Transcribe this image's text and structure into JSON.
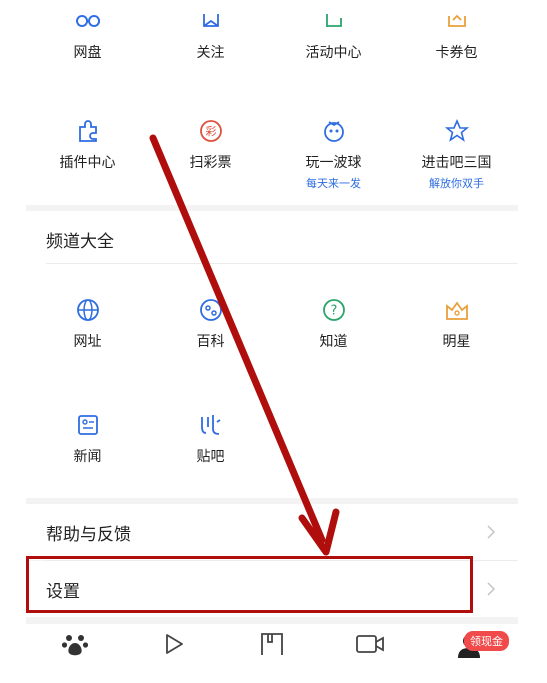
{
  "top_row": [
    {
      "icon": "cloud-drive-icon",
      "label": "网盘",
      "color": "#2f6de1"
    },
    {
      "icon": "follow-icon",
      "label": "关注",
      "color": "#2f6de1"
    },
    {
      "icon": "flag-icon",
      "label": "活动中心",
      "color": "#2aa56b"
    },
    {
      "icon": "coupon-icon",
      "label": "卡券包",
      "color": "#e8a13a"
    }
  ],
  "second_row": [
    {
      "icon": "plugin-icon",
      "label": "插件中心",
      "sub": "",
      "color": "#2f6de1"
    },
    {
      "icon": "lottery-icon",
      "label": "扫彩票",
      "sub": "",
      "color": "#e0503f"
    },
    {
      "icon": "game-ball-icon",
      "label": "玩一波球",
      "sub": "每天来一发",
      "color": "#2f6de1"
    },
    {
      "icon": "game-star-icon",
      "label": "进击吧三国",
      "sub": "解放你双手",
      "color": "#2f6de1"
    }
  ],
  "channels": {
    "title": "频道大全",
    "row1": [
      {
        "icon": "globe-icon",
        "label": "网址",
        "color": "#2f6de1"
      },
      {
        "icon": "encyclopedia-icon",
        "label": "百科",
        "color": "#2f6de1"
      },
      {
        "icon": "question-icon",
        "label": "知道",
        "color": "#2aa56b"
      },
      {
        "icon": "crown-icon",
        "label": "明星",
        "color": "#e8a13a"
      }
    ],
    "row2": [
      {
        "icon": "news-icon",
        "label": "新闻",
        "color": "#2f6de1"
      },
      {
        "icon": "tieba-icon",
        "label": "贴吧",
        "color": "#2f6de1"
      }
    ]
  },
  "menu": {
    "help_label": "帮助与反馈",
    "settings_label": "设置"
  },
  "tabbar": {
    "items": [
      "home-paw-icon",
      "play-icon",
      "bookmark-icon",
      "video-icon",
      "profile-icon"
    ],
    "badge": "领现金"
  },
  "colors": {
    "annotation": "#b00d0d",
    "accent_blue": "#2f6de1",
    "badge_red": "#f04a4a"
  }
}
